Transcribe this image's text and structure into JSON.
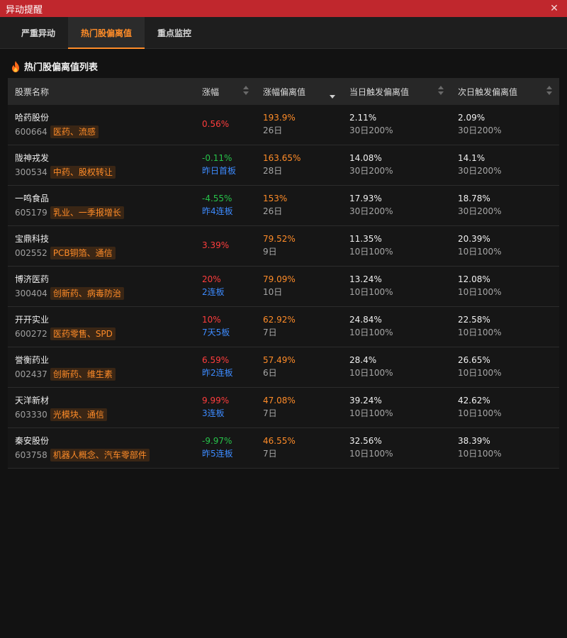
{
  "window": {
    "title": "异动提醒",
    "close_glyph": "✕"
  },
  "tabs": [
    {
      "label": "严重异动",
      "active": false
    },
    {
      "label": "热门股偏离值",
      "active": true
    },
    {
      "label": "重点监控",
      "active": false
    }
  ],
  "section": {
    "title": "热门股偏离值列表",
    "icon": "fire-icon"
  },
  "table": {
    "headers": [
      "股票名称",
      "涨幅",
      "涨幅偏离值",
      "当日触发偏离值",
      "次日触发偏离值"
    ],
    "sorted_by": "涨幅偏离值",
    "sort_direction": "desc",
    "rows": [
      {
        "name": "哈药股份",
        "code": "600664",
        "tags": "医药、流感",
        "change": "0.56%",
        "change_dir": "up",
        "board": "",
        "deviation": "193.9%",
        "days": "26日",
        "today_val": "2.11%",
        "today_rule": "30日200%",
        "next_val": "2.09%",
        "next_rule": "30日200%"
      },
      {
        "name": "陇神戎发",
        "code": "300534",
        "tags": "中药、股权转让",
        "change": "-0.11%",
        "change_dir": "down",
        "board": "昨日首板",
        "deviation": "163.65%",
        "days": "28日",
        "today_val": "14.08%",
        "today_rule": "30日200%",
        "next_val": "14.1%",
        "next_rule": "30日200%"
      },
      {
        "name": "一鸣食品",
        "code": "605179",
        "tags": "乳业、一季报增长",
        "change": "-4.55%",
        "change_dir": "down",
        "board": "昨4连板",
        "deviation": "153%",
        "days": "26日",
        "today_val": "17.93%",
        "today_rule": "30日200%",
        "next_val": "18.78%",
        "next_rule": "30日200%"
      },
      {
        "name": "宝鼎科技",
        "code": "002552",
        "tags": "PCB铜箔、通信",
        "change": "3.39%",
        "change_dir": "up",
        "board": "",
        "deviation": "79.52%",
        "days": "9日",
        "today_val": "11.35%",
        "today_rule": "10日100%",
        "next_val": "20.39%",
        "next_rule": "10日100%"
      },
      {
        "name": "博济医药",
        "code": "300404",
        "tags": "创新药、病毒防治",
        "change": "20%",
        "change_dir": "up",
        "board": "2连板",
        "deviation": "79.09%",
        "days": "10日",
        "today_val": "13.24%",
        "today_rule": "10日100%",
        "next_val": "12.08%",
        "next_rule": "10日100%"
      },
      {
        "name": "开开实业",
        "code": "600272",
        "tags": "医药零售、SPD",
        "change": "10%",
        "change_dir": "up",
        "board": "7天5板",
        "deviation": "62.92%",
        "days": "7日",
        "today_val": "24.84%",
        "today_rule": "10日100%",
        "next_val": "22.58%",
        "next_rule": "10日100%"
      },
      {
        "name": "誉衡药业",
        "code": "002437",
        "tags": "创新药、维生素",
        "change": "6.59%",
        "change_dir": "up",
        "board": "昨2连板",
        "deviation": "57.49%",
        "days": "6日",
        "today_val": "28.4%",
        "today_rule": "10日100%",
        "next_val": "26.65%",
        "next_rule": "10日100%"
      },
      {
        "name": "天洋新材",
        "code": "603330",
        "tags": "光模块、通信",
        "change": "9.99%",
        "change_dir": "up",
        "board": "3连板",
        "deviation": "47.08%",
        "days": "7日",
        "today_val": "39.24%",
        "today_rule": "10日100%",
        "next_val": "42.62%",
        "next_rule": "10日100%"
      },
      {
        "name": "秦安股份",
        "code": "603758",
        "tags": "机器人概念、汽车零部件",
        "change": "-9.97%",
        "change_dir": "down",
        "board": "昨5连板",
        "deviation": "46.55%",
        "days": "7日",
        "today_val": "32.56%",
        "today_rule": "10日100%",
        "next_val": "38.39%",
        "next_rule": "10日100%"
      }
    ]
  },
  "colors": {
    "title_bar": "#c0272d",
    "accent": "#ff8c28",
    "up": "#ff3d3d",
    "down": "#27c34a",
    "board": "#3d8bff"
  }
}
